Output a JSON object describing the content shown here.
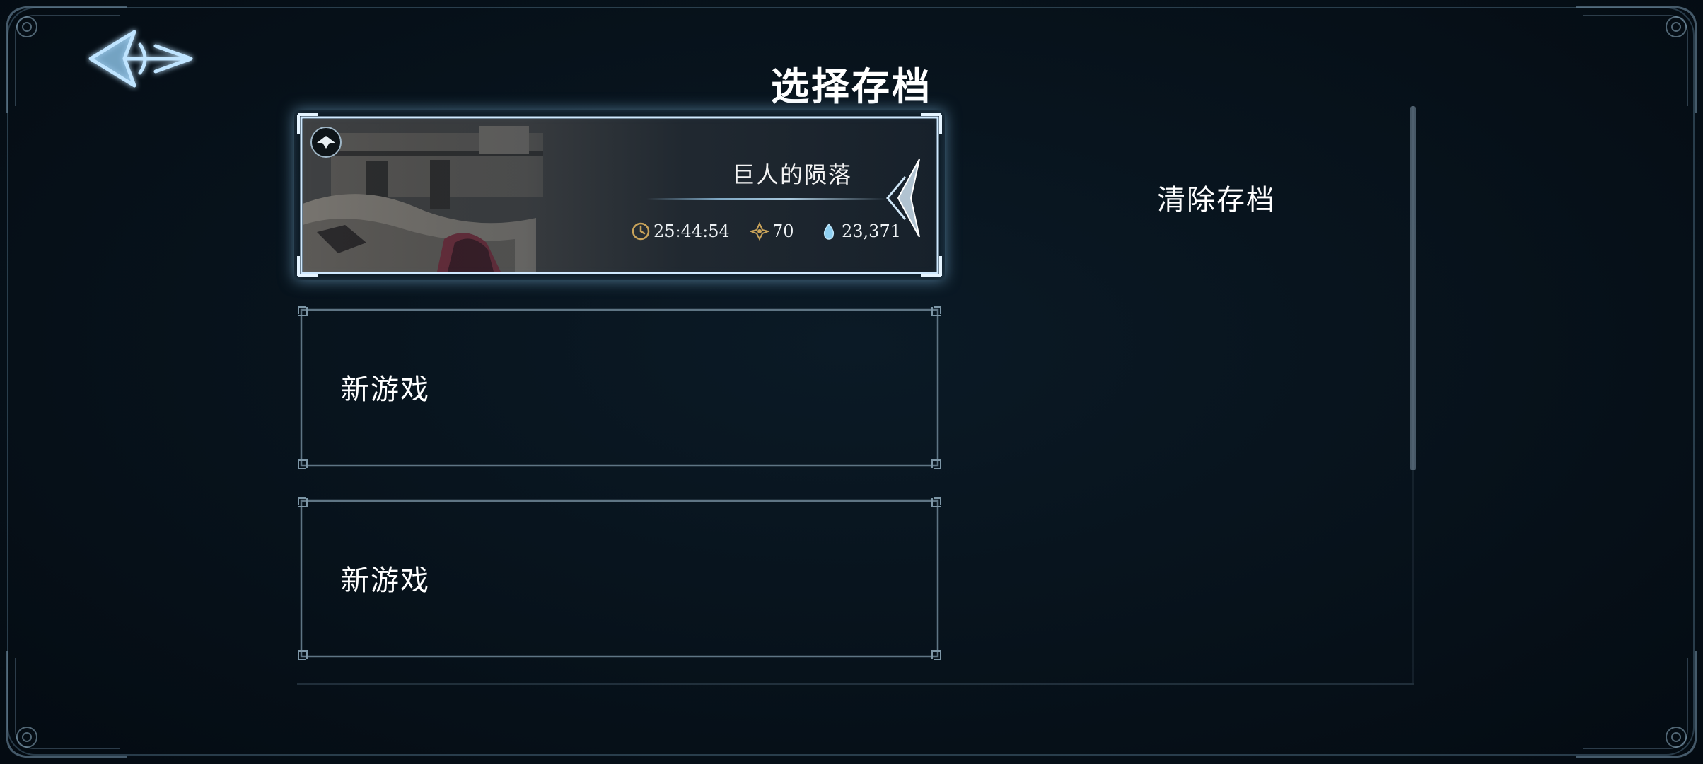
{
  "header": {
    "title": "选择存档"
  },
  "slots": [
    {
      "type": "save",
      "chapter": "巨人的陨落",
      "playtime": "25:44:54",
      "level": "70",
      "currency": "23,371"
    },
    {
      "type": "empty",
      "label": "新游戏"
    },
    {
      "type": "empty",
      "label": "新游戏"
    }
  ],
  "actions": {
    "delete_save_label": "清除存档"
  },
  "icons": {
    "back": "back-arrow-icon",
    "badge": "save-emblem-icon",
    "time": "clock-icon",
    "level": "level-sigil-icon",
    "currency": "water-drop-icon"
  },
  "colors": {
    "background": "#07121b",
    "accent": "#a9d4f2",
    "gold": "#c9a35a",
    "text": "#ffffff"
  }
}
